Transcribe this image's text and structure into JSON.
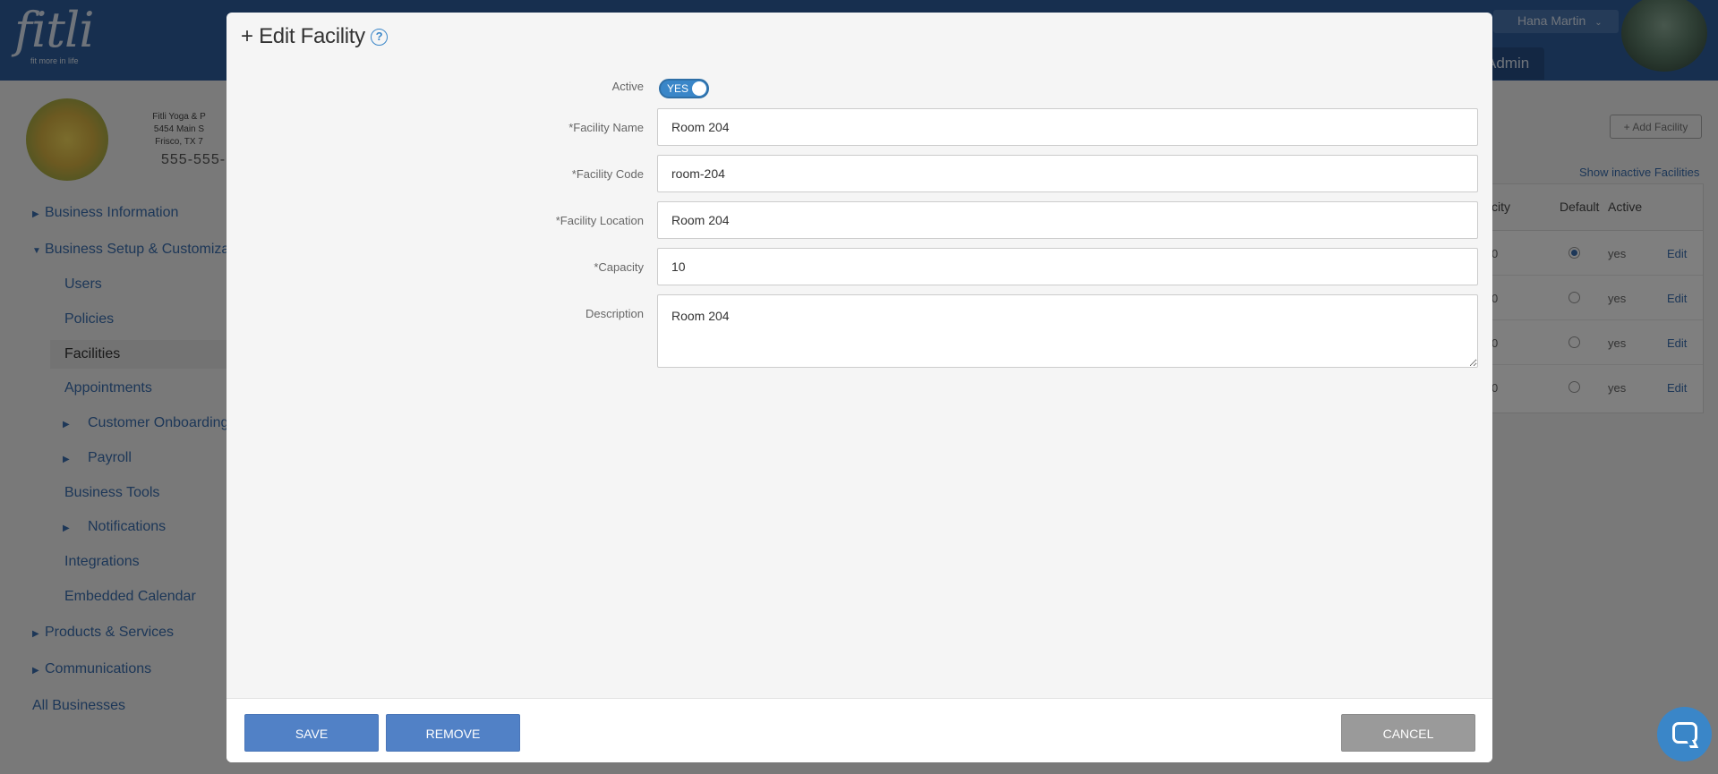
{
  "app": {
    "logo_text": "fitli",
    "logo_tagline": "fit more in life",
    "user_name": "Hana Martin",
    "admin_tab": "Admin"
  },
  "business": {
    "name": "Fitli Yoga & P",
    "address_line1": "5454 Main S",
    "address_line2": "Frisco, TX 7",
    "phone": "555-555-"
  },
  "sidebar": {
    "items": [
      {
        "label": "Business Information",
        "expander": "collapsed"
      },
      {
        "label": "Business Setup & Customiza",
        "expander": "expanded"
      },
      {
        "label": "Users"
      },
      {
        "label": "Policies"
      },
      {
        "label": "Facilities",
        "active": true
      },
      {
        "label": "Appointments"
      },
      {
        "label": "Customer Onboarding",
        "expander": "collapsed"
      },
      {
        "label": "Payroll",
        "expander": "collapsed"
      },
      {
        "label": "Business Tools"
      },
      {
        "label": "Notifications",
        "expander": "collapsed"
      },
      {
        "label": "Integrations"
      },
      {
        "label": "Embedded Calendar"
      },
      {
        "label": "Products & Services",
        "expander": "collapsed"
      },
      {
        "label": "Communications",
        "expander": "collapsed"
      },
      {
        "label": "All Businesses"
      }
    ]
  },
  "facilities_page": {
    "add_button": "+ Add Facility",
    "show_inactive_link": "Show inactive Facilities",
    "columns": [
      "city",
      "Default",
      "Active"
    ],
    "rows": [
      {
        "capacity": "0",
        "default": true,
        "active": "yes",
        "action": "Edit"
      },
      {
        "capacity": "0",
        "default": false,
        "active": "yes",
        "action": "Edit"
      },
      {
        "capacity": "0",
        "default": false,
        "active": "yes",
        "action": "Edit"
      },
      {
        "capacity": "0",
        "default": false,
        "active": "yes",
        "action": "Edit"
      }
    ]
  },
  "modal": {
    "title": "+ Edit Facility",
    "help_icon": "?",
    "fields": {
      "active_label": "Active",
      "active_toggle": "YES",
      "name_label": "*Facility Name",
      "name_value": "Room 204",
      "code_label": "*Facility Code",
      "code_value": "room-204",
      "location_label": "*Facility Location",
      "location_value": "Room 204",
      "capacity_label": "*Capacity",
      "capacity_value": "10",
      "description_label": "Description",
      "description_value": "Room 204"
    },
    "buttons": {
      "save": "SAVE",
      "remove": "REMOVE",
      "cancel": "CANCEL"
    }
  },
  "colors": {
    "primary": "#5181c6",
    "topbar": "#2f5f9e",
    "toggle_on": "#3a86c8",
    "cancel": "#9a9a9a"
  },
  "icons": [
    "help-icon",
    "chevron-down-icon",
    "chat-icon",
    "caret-right-icon",
    "caret-down-icon"
  ]
}
